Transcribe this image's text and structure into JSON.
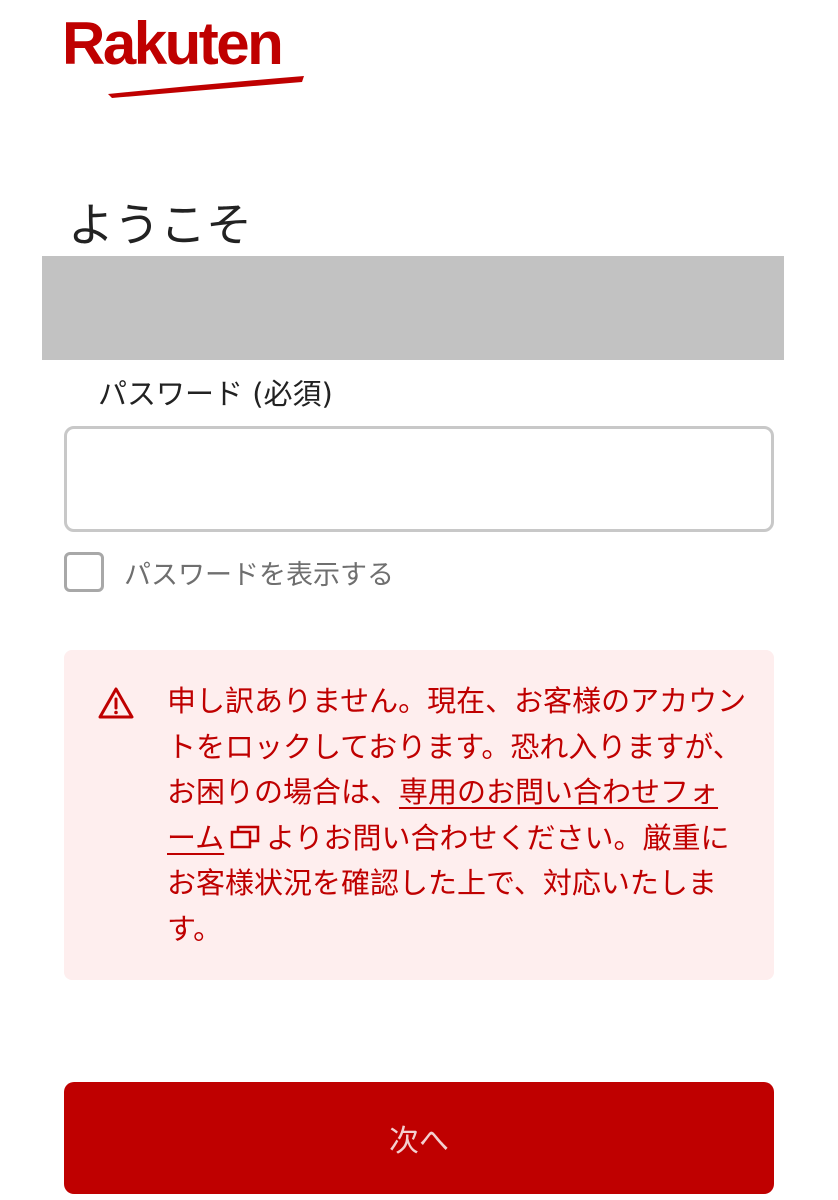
{
  "brand": {
    "logo_text": "Rakuten",
    "color": "#bf0000"
  },
  "welcome": {
    "title": "ようこそ"
  },
  "password": {
    "label": "パスワード (必須)",
    "value": "",
    "show_password_label": "パスワードを表示する",
    "show_password_checked": false
  },
  "alert": {
    "icon": "warning-triangle-icon",
    "text_before_link": "申し訳ありません。現在、お客様のアカウントをロックしております。恐れ入りますが、お困りの場合は、",
    "link_text": "専用のお問い合わせフォーム",
    "link_icon": "external-window-icon",
    "text_after_link": "よりお問い合わせください。厳重にお客様状況を確認した上で、対応いたします。",
    "color": "#bf0000",
    "background": "#feeeee"
  },
  "actions": {
    "next_label": "次へ"
  }
}
